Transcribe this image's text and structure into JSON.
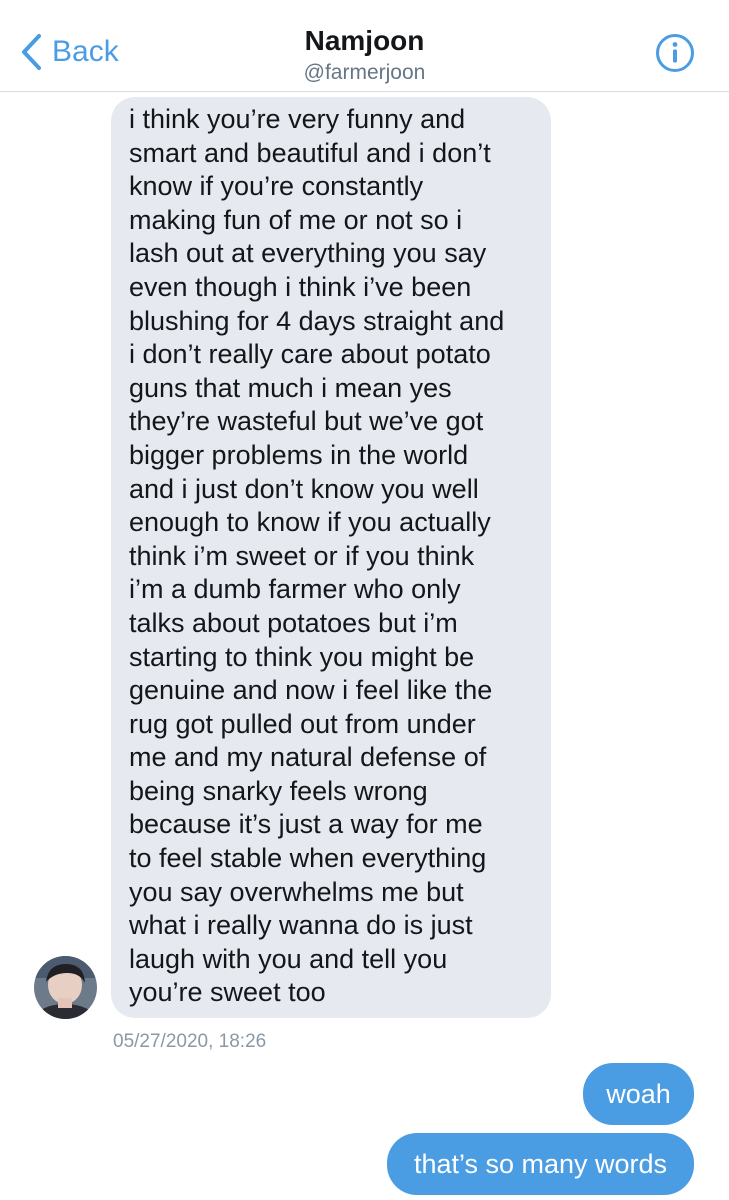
{
  "header": {
    "back_label": "Back",
    "contact_name": "Namjoon",
    "contact_handle": "@farmerjoon",
    "icons": {
      "back": "chevron-left-icon",
      "info": "info-circle-icon"
    }
  },
  "conversation": {
    "incoming": {
      "text": "i think you’re very funny and\nsmart and beautiful and i don’t\nknow if you’re constantly\nmaking fun of me or not so i\nlash out at everything you say\neven though i think i’ve been\nblushing for 4 days straight and\ni don’t really care about potato\nguns that much i mean yes\nthey’re wasteful but we’ve got\nbigger problems in the world\nand i just don’t know you well\nenough to know if you actually\nthink i’m sweet or if you think\ni’m a dumb farmer who only\ntalks about potatoes but i’m\nstarting to think you might be\ngenuine and now i feel like the\nrug got pulled out from under\nme and my natural defense of\nbeing snarky feels wrong\nbecause it’s just a way for me\nto feel stable when everything\nyou say overwhelms me but\nwhat i really wanna do is just\nlaugh with you and tell you\nyou’re sweet too",
      "timestamp": "05/27/2020, 18:26"
    },
    "outgoing": [
      {
        "text": "woah"
      },
      {
        "text": "that’s so many words"
      }
    ]
  },
  "colors": {
    "accent": "#4a9ce3",
    "incoming_bubble": "#e6e9ef",
    "divider": "#d9dde1",
    "muted_text": "#8b98a5"
  }
}
